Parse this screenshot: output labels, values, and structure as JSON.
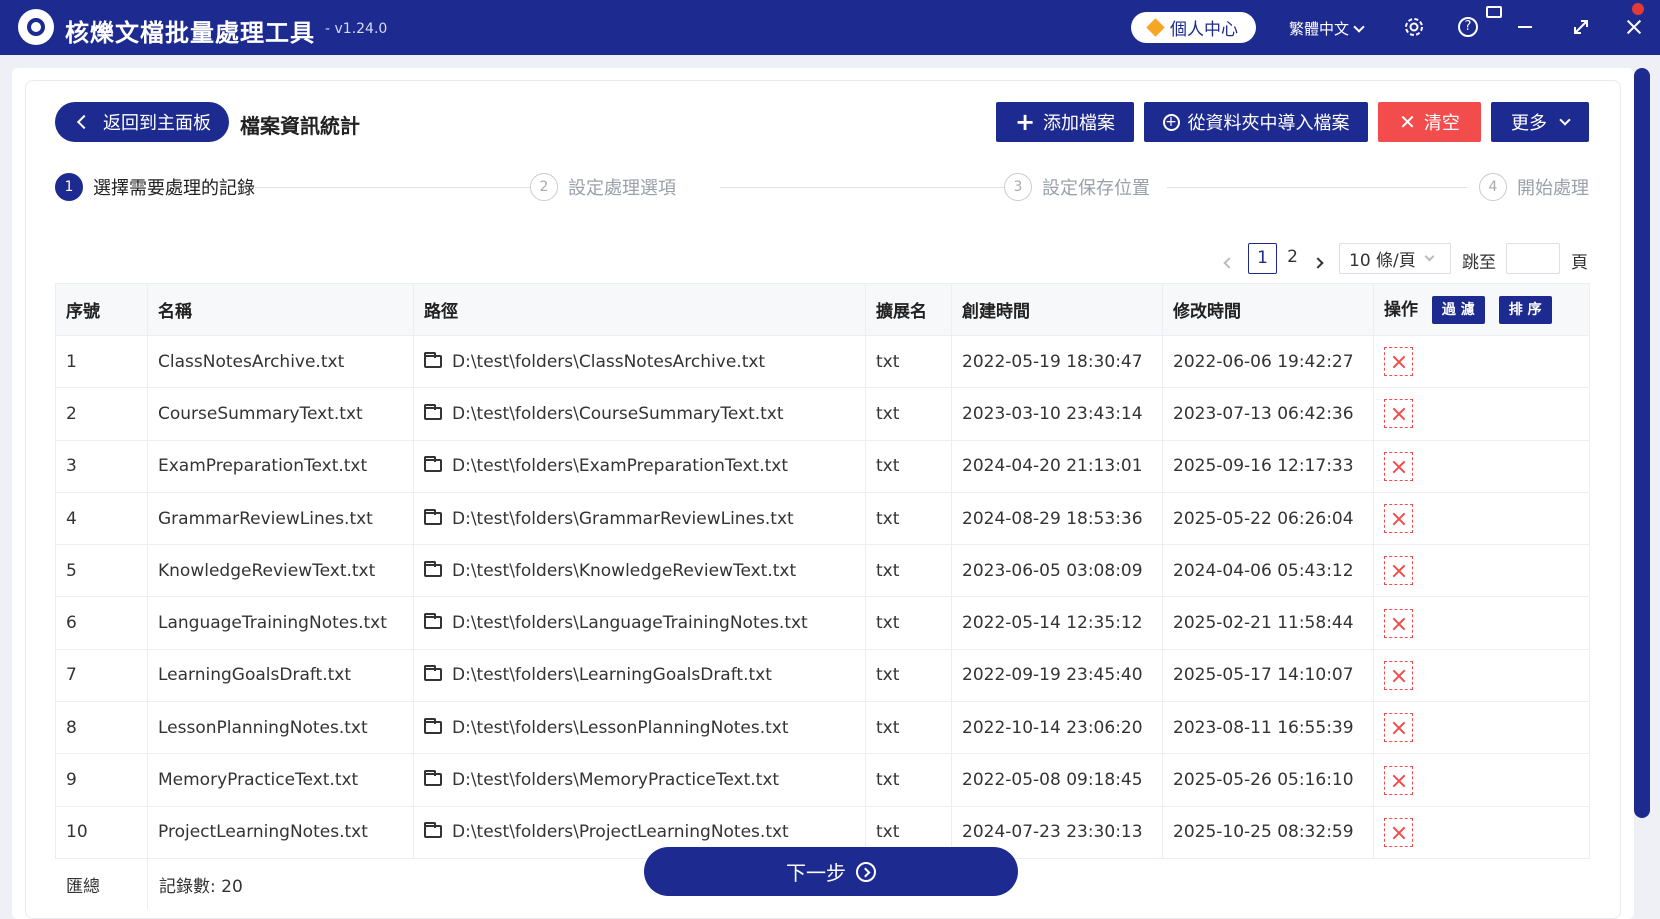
{
  "app": {
    "title": "核爍文檔批量處理工具",
    "version": "- v1.24.0",
    "personal_center": "個人中心",
    "language": "繁體中文"
  },
  "toolbar": {
    "back_label": "返回到主面板",
    "page_title": "檔案資訊統計",
    "add_files": "添加檔案",
    "import_folder": "從資料夾中導入檔案",
    "clear": "清空",
    "more": "更多"
  },
  "steps": [
    {
      "num": "1",
      "label": "選擇需要處理的記錄"
    },
    {
      "num": "2",
      "label": "設定處理選項"
    },
    {
      "num": "3",
      "label": "設定保存位置"
    },
    {
      "num": "4",
      "label": "開始處理"
    }
  ],
  "pagination": {
    "pages": [
      "1",
      "2"
    ],
    "page_size": "10 條/頁",
    "goto_label": "跳至",
    "page_unit": "頁"
  },
  "table": {
    "headers": [
      "序號",
      "名稱",
      "路徑",
      "擴展名",
      "創建時間",
      "修改時間",
      "操作"
    ],
    "filter_label": "過 濾",
    "sort_label": "排 序",
    "rows": [
      {
        "no": "1",
        "name": "ClassNotesArchive.txt",
        "path": "D:\\test\\folders\\ClassNotesArchive.txt",
        "ext": "txt",
        "created": "2022-05-19 18:30:47",
        "modified": "2022-06-06 19:42:27"
      },
      {
        "no": "2",
        "name": "CourseSummaryText.txt",
        "path": "D:\\test\\folders\\CourseSummaryText.txt",
        "ext": "txt",
        "created": "2023-03-10 23:43:14",
        "modified": "2023-07-13 06:42:36"
      },
      {
        "no": "3",
        "name": "ExamPreparationText.txt",
        "path": "D:\\test\\folders\\ExamPreparationText.txt",
        "ext": "txt",
        "created": "2024-04-20 21:13:01",
        "modified": "2025-09-16 12:17:33"
      },
      {
        "no": "4",
        "name": "GrammarReviewLines.txt",
        "path": "D:\\test\\folders\\GrammarReviewLines.txt",
        "ext": "txt",
        "created": "2024-08-29 18:53:36",
        "modified": "2025-05-22 06:26:04"
      },
      {
        "no": "5",
        "name": "KnowledgeReviewText.txt",
        "path": "D:\\test\\folders\\KnowledgeReviewText.txt",
        "ext": "txt",
        "created": "2023-06-05 03:08:09",
        "modified": "2024-04-06 05:43:12"
      },
      {
        "no": "6",
        "name": "LanguageTrainingNotes.txt",
        "path": "D:\\test\\folders\\LanguageTrainingNotes.txt",
        "ext": "txt",
        "created": "2022-05-14 12:35:12",
        "modified": "2025-02-21 11:58:44"
      },
      {
        "no": "7",
        "name": "LearningGoalsDraft.txt",
        "path": "D:\\test\\folders\\LearningGoalsDraft.txt",
        "ext": "txt",
        "created": "2022-09-19 23:45:40",
        "modified": "2025-05-17 14:10:07"
      },
      {
        "no": "8",
        "name": "LessonPlanningNotes.txt",
        "path": "D:\\test\\folders\\LessonPlanningNotes.txt",
        "ext": "txt",
        "created": "2022-10-14 23:06:20",
        "modified": "2023-08-11 16:55:39"
      },
      {
        "no": "9",
        "name": "MemoryPracticeText.txt",
        "path": "D:\\test\\folders\\MemoryPracticeText.txt",
        "ext": "txt",
        "created": "2022-05-08 09:18:45",
        "modified": "2025-05-26 05:16:10"
      },
      {
        "no": "10",
        "name": "ProjectLearningNotes.txt",
        "path": "D:\\test\\folders\\ProjectLearningNotes.txt",
        "ext": "txt",
        "created": "2024-07-23 23:30:13",
        "modified": "2025-10-25 08:32:59"
      }
    ]
  },
  "summary": {
    "label": "匯總",
    "count": "記錄數: 20"
  },
  "next_label": "下一步",
  "colors": {
    "primary": "#1d2a8f",
    "danger": "#f24c4c"
  }
}
